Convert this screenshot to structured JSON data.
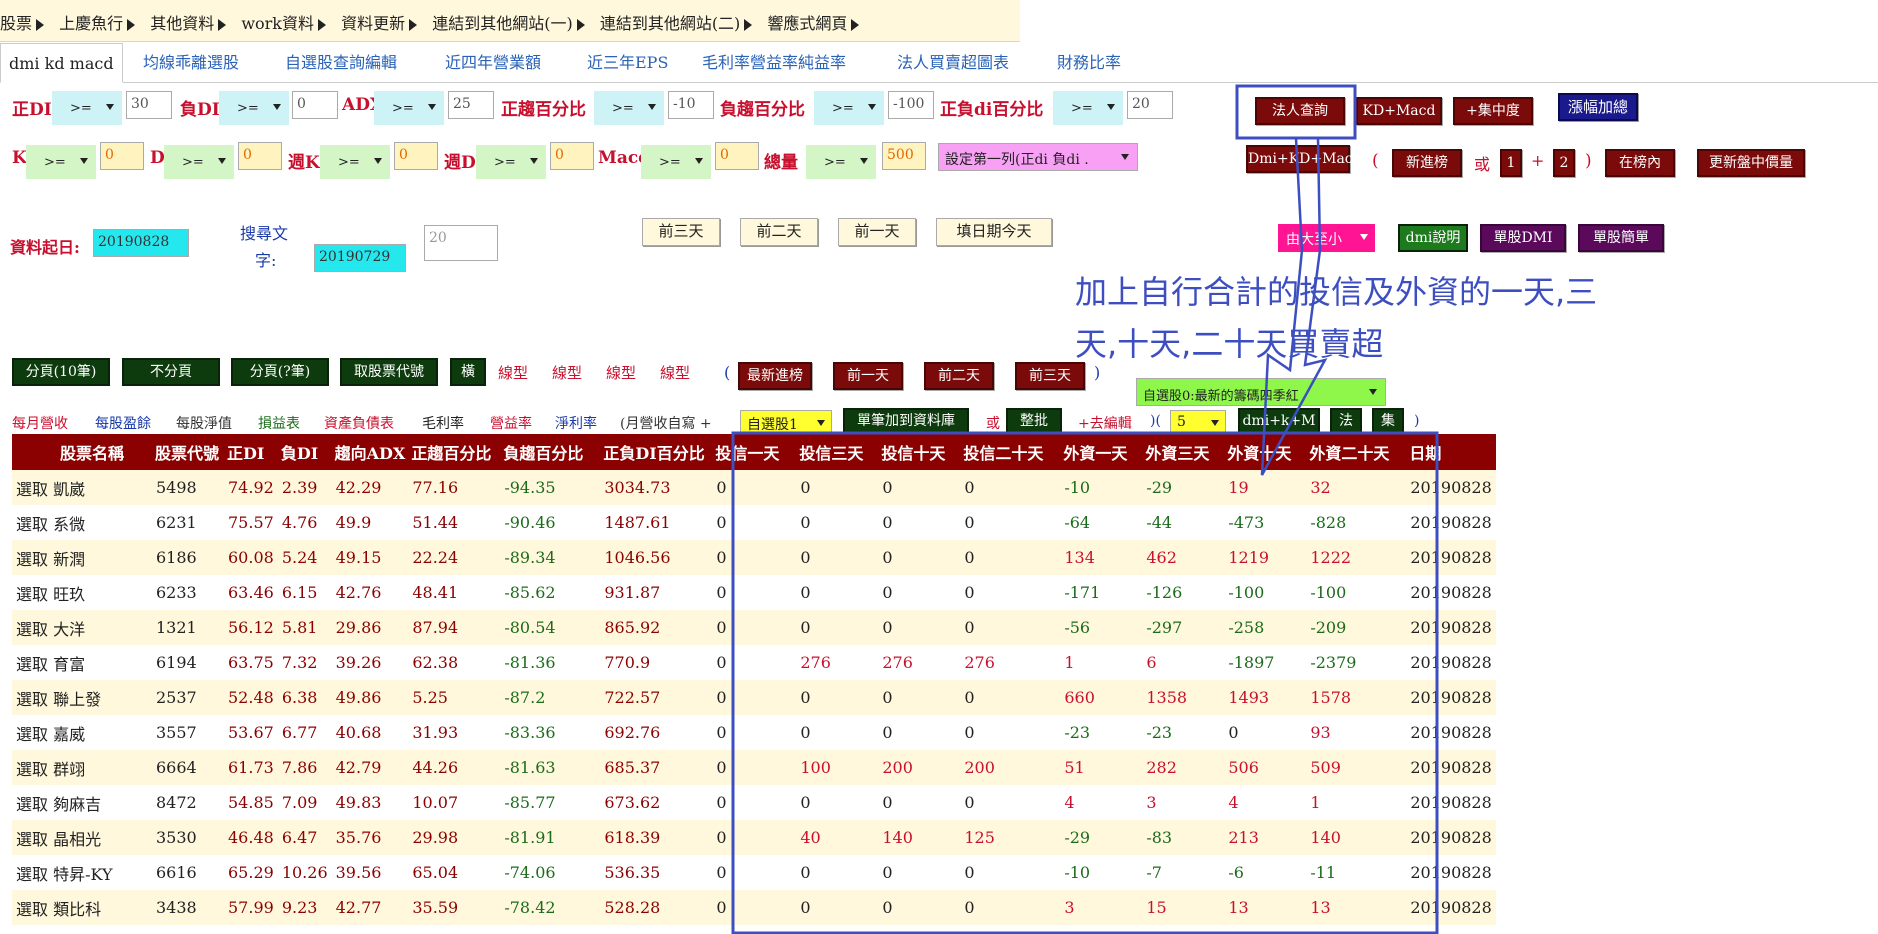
{
  "top_menu": [
    "股票",
    "上慶魚行",
    "其他資料",
    "work資料",
    "資料更新",
    "連結到其他網站(一)",
    "連結到其他網站(二)",
    "響應式網頁"
  ],
  "tabs": [
    "dmi kd macd",
    "均線乖離選股",
    "自選股查詢編輯",
    "近四年營業額",
    "近三年EPS",
    "毛利率營益率純益率",
    "法人買賣超圖表",
    "財務比率"
  ],
  "filters_row1": {
    "pos_di": {
      "label": "正DI",
      "op": ">=",
      "value": "30"
    },
    "neg_di": {
      "label": "負DI",
      "op": ">=",
      "value": "0"
    },
    "adx": {
      "label": "ADX",
      "op": ">=",
      "value": "25"
    },
    "pos_trend": {
      "label": "正趨百分比",
      "op": ">=",
      "value": "-10"
    },
    "neg_trend": {
      "label": "負趨百分比",
      "op": ">=",
      "value": "-100"
    },
    "pn_di": {
      "label": "正負di百分比",
      "op": ">=",
      "value": "20"
    }
  },
  "filters_row2": {
    "k": {
      "label": "K",
      "op": ">=",
      "value": "0"
    },
    "d": {
      "label": "D",
      "op": ">=",
      "value": "0"
    },
    "wk": {
      "label": "週K",
      "op": ">=",
      "value": "0"
    },
    "wd": {
      "label": "週D",
      "op": ">=",
      "value": "0"
    },
    "macd": {
      "label": "Macd",
      "op": ">=",
      "value": "0"
    },
    "vol": {
      "label": "總量",
      "op": ">=",
      "value": "500"
    },
    "sort_select": "設定第一列(正di 負di ."
  },
  "right_buttons": {
    "inst_query": "法人查詢",
    "kd_macd": "KD+Macd",
    "concentration": "+集中度",
    "price_sum": "漲幅加總",
    "dmi_kd_macd": "Dmi+KD+Macd",
    "paren_open": "(",
    "new_entry": "新進榜",
    "or": "或",
    "one": "1",
    "plus": "+",
    "two": "2",
    "paren_close": ")",
    "in_list": "在榜內",
    "update_price": "更新盤中價量",
    "sort_order": "由大至小",
    "dmi_help": "dmi說明",
    "single_dmi": "單股DMI",
    "single_simple": "單股簡單"
  },
  "date_row": {
    "start_label": "資料起日:",
    "start_value": "20190828",
    "search_label_1": "搜尋文",
    "search_label_2": "字:",
    "search_date": "20190729",
    "textarea_value": "20",
    "prev3": "前三天",
    "prev2": "前二天",
    "prev1": "前一天",
    "fill_today": "填日期今天"
  },
  "annotation": "加上自行合計的投信及外資的一天,三天,十天,二十天買賣超",
  "row_buttons": {
    "page10": "分頁(10筆)",
    "nopage": "不分頁",
    "pageq": "分頁(?筆)",
    "get_codes": "取股票代號",
    "horiz": "橫",
    "types": [
      "線型",
      "線型",
      "線型",
      "線型"
    ],
    "paren_open": "(",
    "newest": "最新進榜",
    "p1": "前一天",
    "p2": "前二天",
    "p3": "前三天",
    "paren_close": ")"
  },
  "watchlist_select": "自選股0:最新的籌碼四季紅",
  "links_row": {
    "monthly": "每月營收",
    "surplus": "每股盈餘",
    "netvalue": "每股淨值",
    "income": "損益表",
    "balance": "資產負債表",
    "gross": "毛利率",
    "opmargin": "營益率",
    "netmargin": "淨利率",
    "monthly_auto": "(月營收自寫 +",
    "watch1": "自選股1",
    "add_db": "單筆加到資料庫",
    "or": "或",
    "batch": "整批",
    "edit": "+去編輯",
    "paren": ")(",
    "count": "5",
    "dmikm": "dmi+k+M",
    "fa": "法",
    "ji": "集",
    "close": ")"
  },
  "table": {
    "headers": [
      "股票名稱",
      "股票代號",
      "正DI",
      "負DI",
      "趨向ADX",
      "正趨百分比",
      "負趨百分比",
      "正負DI百分比",
      "投信一天",
      "投信三天",
      "投信十天",
      "投信二十天",
      "外資一天",
      "外資三天",
      "外資十天",
      "外資二十天",
      "日期"
    ],
    "rows": [
      [
        "選取 凱崴",
        "5498",
        "74.92",
        "2.39",
        "42.29",
        "77.16",
        "-94.35",
        "3034.73",
        "0",
        "0",
        "0",
        "0",
        "-10",
        "-29",
        "19",
        "32",
        "20190828"
      ],
      [
        "選取 系微",
        "6231",
        "75.57",
        "4.76",
        "49.9",
        "51.44",
        "-90.46",
        "1487.61",
        "0",
        "0",
        "0",
        "0",
        "-64",
        "-44",
        "-473",
        "-828",
        "20190828"
      ],
      [
        "選取 新潤",
        "6186",
        "60.08",
        "5.24",
        "49.15",
        "22.24",
        "-89.34",
        "1046.56",
        "0",
        "0",
        "0",
        "0",
        "134",
        "462",
        "1219",
        "1222",
        "20190828"
      ],
      [
        "選取 旺玖",
        "6233",
        "63.46",
        "6.15",
        "42.76",
        "48.41",
        "-85.62",
        "931.87",
        "0",
        "0",
        "0",
        "0",
        "-171",
        "-126",
        "-100",
        "-100",
        "20190828"
      ],
      [
        "選取 大洋",
        "1321",
        "56.12",
        "5.81",
        "29.86",
        "87.94",
        "-80.54",
        "865.92",
        "0",
        "0",
        "0",
        "0",
        "-56",
        "-297",
        "-258",
        "-209",
        "20190828"
      ],
      [
        "選取 育富",
        "6194",
        "63.75",
        "7.32",
        "39.26",
        "62.38",
        "-81.36",
        "770.9",
        "0",
        "276",
        "276",
        "276",
        "1",
        "6",
        "-1897",
        "-2379",
        "20190828"
      ],
      [
        "選取 聯上發",
        "2537",
        "52.48",
        "6.38",
        "49.86",
        "5.25",
        "-87.2",
        "722.57",
        "0",
        "0",
        "0",
        "0",
        "660",
        "1358",
        "1493",
        "1578",
        "20190828"
      ],
      [
        "選取 嘉威",
        "3557",
        "53.67",
        "6.77",
        "40.68",
        "31.93",
        "-83.36",
        "692.76",
        "0",
        "0",
        "0",
        "0",
        "-23",
        "-23",
        "0",
        "93",
        "20190828"
      ],
      [
        "選取 群翊",
        "6664",
        "61.73",
        "7.86",
        "42.79",
        "44.26",
        "-81.63",
        "685.37",
        "0",
        "100",
        "200",
        "200",
        "51",
        "282",
        "506",
        "509",
        "20190828"
      ],
      [
        "選取 夠麻吉",
        "8472",
        "54.85",
        "7.09",
        "49.83",
        "10.07",
        "-85.77",
        "673.62",
        "0",
        "0",
        "0",
        "0",
        "4",
        "3",
        "4",
        "1",
        "20190828"
      ],
      [
        "選取 晶相光",
        "3530",
        "46.48",
        "6.47",
        "35.76",
        "29.98",
        "-81.91",
        "618.39",
        "0",
        "40",
        "140",
        "125",
        "-29",
        "-83",
        "213",
        "140",
        "20190828"
      ],
      [
        "選取 特昇-KY",
        "6616",
        "65.29",
        "10.26",
        "39.56",
        "65.04",
        "-74.06",
        "536.35",
        "0",
        "0",
        "0",
        "0",
        "-10",
        "-7",
        "-6",
        "-11",
        "20190828"
      ],
      [
        "選取 類比科",
        "3438",
        "57.99",
        "9.23",
        "42.77",
        "35.59",
        "-78.42",
        "528.28",
        "0",
        "0",
        "0",
        "0",
        "3",
        "15",
        "13",
        "13",
        "20190828"
      ]
    ]
  }
}
